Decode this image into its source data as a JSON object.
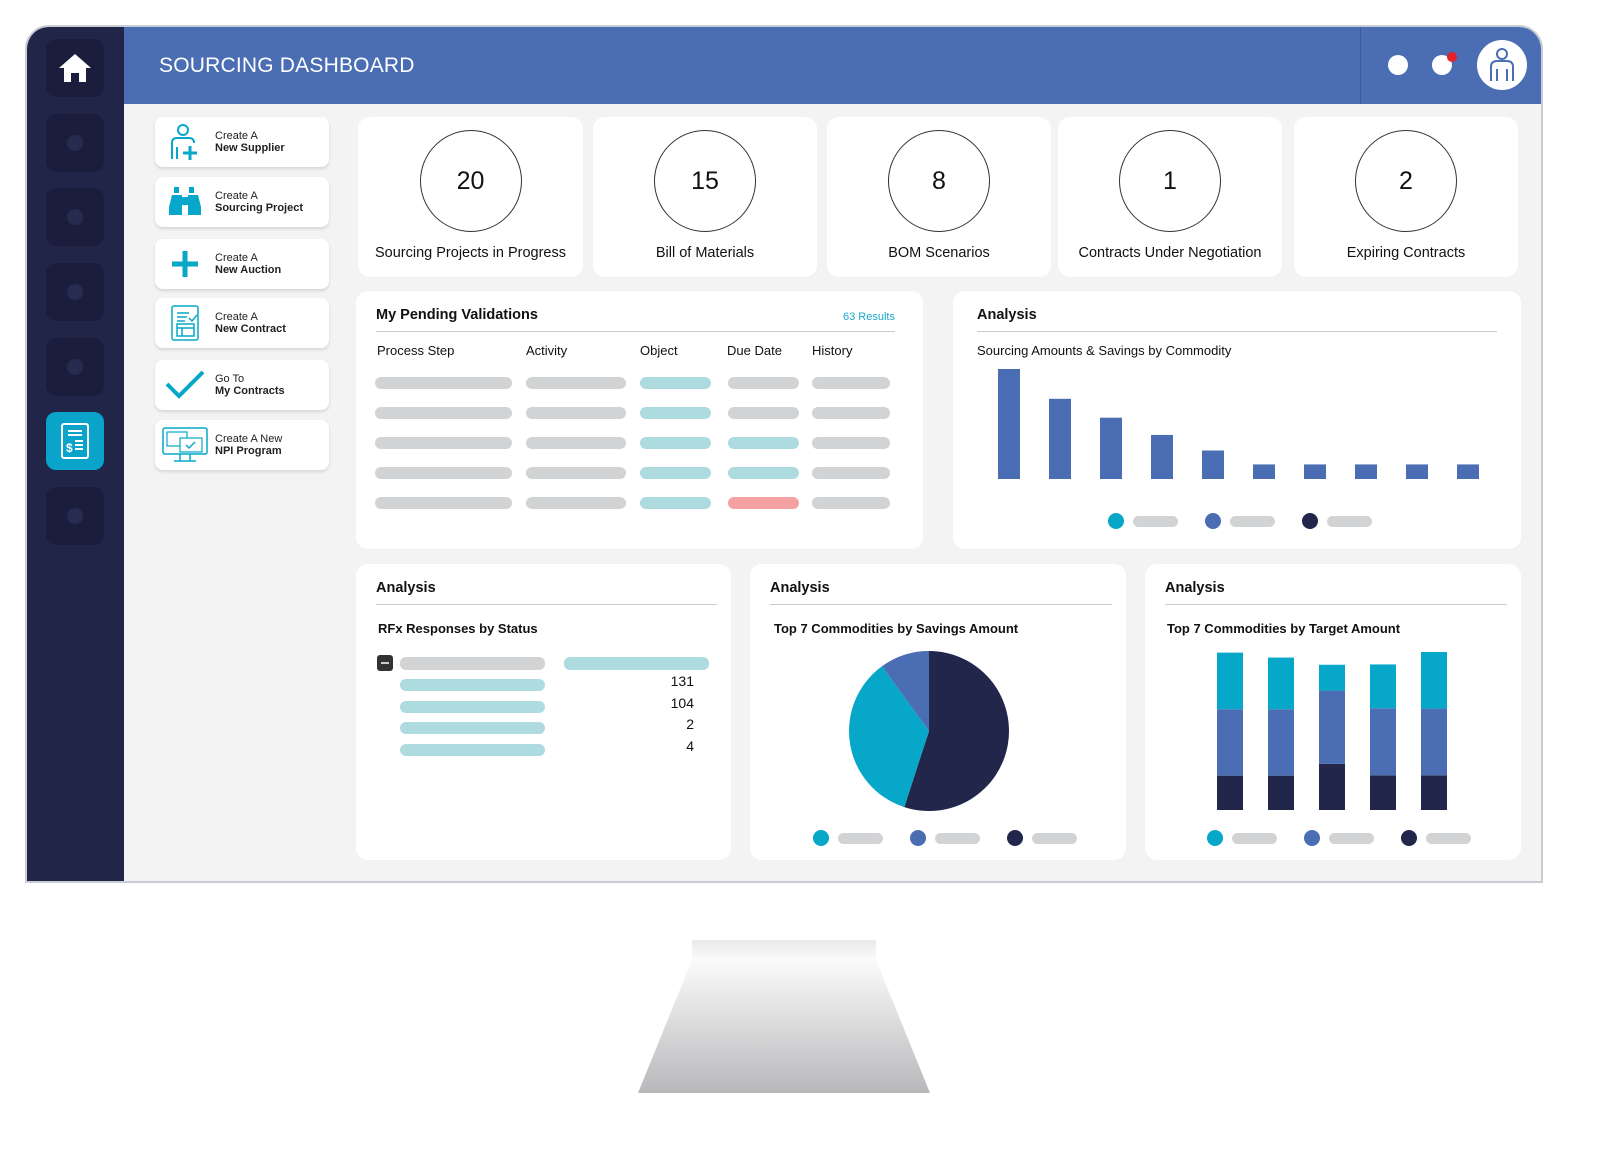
{
  "header": {
    "title": "SOURCING DASHBOARD"
  },
  "sidebar": {
    "items": [
      "home-icon",
      "nav-item",
      "nav-item",
      "nav-item",
      "nav-item",
      "invoice-icon",
      "nav-item"
    ],
    "active_index": 5
  },
  "quick_actions": [
    {
      "line1": "Create A",
      "line2": "New Supplier",
      "icon": "add-user-icon"
    },
    {
      "line1": "Create A",
      "line2": "Sourcing Project",
      "icon": "binoculars-icon"
    },
    {
      "line1": "Create A",
      "line2": "New Auction",
      "icon": "plus-icon"
    },
    {
      "line1": "Create A",
      "line2": "New Contract",
      "icon": "contract-icon"
    },
    {
      "line1": "Go To",
      "line2": "My Contracts",
      "icon": "checkmark-icon"
    },
    {
      "line1": "Create A New",
      "line2": "NPI Program",
      "icon": "monitor-icon"
    }
  ],
  "kpis": [
    {
      "value": "20",
      "label": "Sourcing Projects in Progress"
    },
    {
      "value": "15",
      "label": "Bill of Materials"
    },
    {
      "value": "8",
      "label": "BOM Scenarios"
    },
    {
      "value": "1",
      "label": "Contracts Under Negotiation"
    },
    {
      "value": "2",
      "label": "Expiring Contracts"
    }
  ],
  "validations": {
    "title": "My Pending Validations",
    "results": "63 Results",
    "columns": [
      "Process Step",
      "Activity",
      "Object",
      "Due Date",
      "History"
    ],
    "row_status": [
      [
        "g",
        "g",
        "c",
        "g",
        "g"
      ],
      [
        "g",
        "g",
        "c",
        "g",
        "g"
      ],
      [
        "g",
        "g",
        "c",
        "c",
        "g"
      ],
      [
        "g",
        "g",
        "c",
        "c",
        "g"
      ],
      [
        "g",
        "g",
        "c",
        "r",
        "g"
      ]
    ]
  },
  "colors": {
    "cyan": "#07a7c9",
    "blue": "#4a6db3",
    "navy": "#22264b",
    "header": "#4a6db3",
    "sidebar": "#212649",
    "placeholder_gray": "#d2d3d5",
    "placeholder_teal": "#aedbe0",
    "overdue_red": "#f3a1a2",
    "notification": "#e5202a"
  },
  "analysis_label": "Analysis",
  "rfx": {
    "title": "RFx Responses by Status",
    "values": [
      "131",
      "104",
      "2",
      "4"
    ]
  },
  "chart_data": [
    {
      "type": "bar",
      "title": "Sourcing Amounts & Savings by Commodity",
      "values": [
        33.2,
        24.2,
        18.5,
        13.3,
        8.6,
        4.4,
        4.4,
        4.4,
        4.4,
        4.4
      ],
      "color": "#4a6db3",
      "legend_colors": [
        "#07a7c9",
        "#4a6db3",
        "#22264b"
      ]
    },
    {
      "type": "pie",
      "title": "Top 7 Commodities by Savings Amount",
      "values": [
        55,
        35,
        10
      ],
      "colors": [
        "#22264b",
        "#07a7c9",
        "#4a6db3"
      ]
    },
    {
      "type": "bar",
      "stacked": true,
      "title": "Top 7 Commodities by Target Amount",
      "series": [
        {
          "color": "#22264b",
          "values": [
            10.5,
            10.5,
            14.1,
            10.6,
            10.6
          ]
        },
        {
          "color": "#4a6db3",
          "values": [
            20.3,
            20.3,
            22.4,
            20.5,
            20.4
          ]
        },
        {
          "color": "#07a7c9",
          "values": [
            17.3,
            15.8,
            7.9,
            13.4,
            17.3
          ]
        }
      ]
    }
  ]
}
